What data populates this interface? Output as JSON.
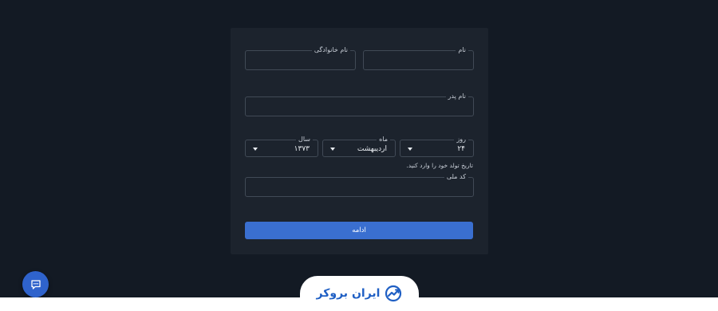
{
  "form": {
    "first_name": {
      "label": "نام",
      "value": ""
    },
    "last_name": {
      "label": "نام خانوادگی",
      "value": ""
    },
    "father_name": {
      "label": "نام پدر",
      "value": ""
    },
    "birth_day": {
      "label": "روز",
      "value": "۲۴"
    },
    "birth_month": {
      "label": "ماه",
      "value": "اردیبهشت"
    },
    "birth_year": {
      "label": "سال",
      "value": "۱۳۷۳"
    },
    "birth_hint": "تاریخ تولد خود را وارد کنید.",
    "national_code": {
      "label": "کد ملی",
      "value": ""
    },
    "continue_label": "ادامه"
  },
  "brand": {
    "name": "ایران بروکر",
    "color": "#1f5fc4"
  },
  "chat": {
    "icon": "chat-bubble-icon"
  },
  "colors": {
    "background": "#131a24",
    "card": "#1c232d",
    "accent": "#3a6fd0"
  }
}
